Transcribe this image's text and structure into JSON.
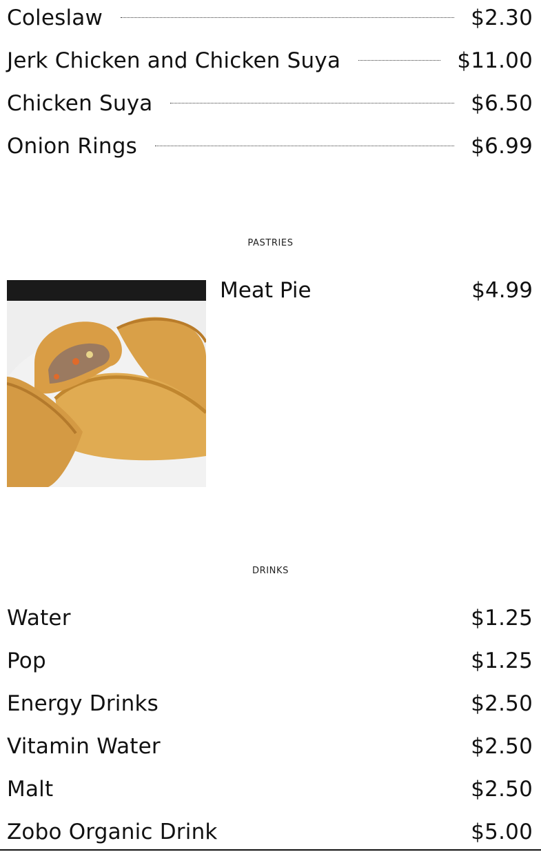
{
  "sides": [
    {
      "name": "Coleslaw",
      "price": "$2.30"
    },
    {
      "name": "Jerk Chicken and Chicken Suya",
      "price": "$11.00"
    },
    {
      "name": "Chicken Suya",
      "price": "$6.50"
    },
    {
      "name": "Onion Rings",
      "price": "$6.99"
    }
  ],
  "pastries": {
    "title": "PASTRIES",
    "items": [
      {
        "name": "Meat Pie",
        "price": "$4.99",
        "image": "meat-pie-photo"
      }
    ]
  },
  "drinks": {
    "title": "DRINKS",
    "items": [
      {
        "name": "Water",
        "price": "$1.25"
      },
      {
        "name": "Pop",
        "price": "$1.25"
      },
      {
        "name": "Energy Drinks",
        "price": "$2.50"
      },
      {
        "name": "Vitamin Water",
        "price": "$2.50"
      },
      {
        "name": "Malt",
        "price": "$2.50"
      },
      {
        "name": "Zobo Organic Drink",
        "price": "$5.00"
      }
    ]
  }
}
